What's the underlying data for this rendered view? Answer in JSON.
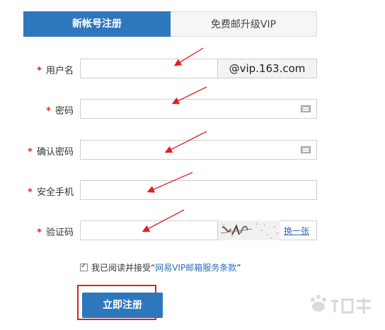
{
  "tabs": [
    {
      "label": "新帐号注册",
      "active": true
    },
    {
      "label": "免费邮升级VIP",
      "active": false
    }
  ],
  "form": {
    "username": {
      "label": "用户名",
      "suffix": "@vip.163.com"
    },
    "password": {
      "label": "密码"
    },
    "confirm_password": {
      "label": "确认密码"
    },
    "phone": {
      "label": "安全手机"
    },
    "captcha": {
      "label": "验证码",
      "refresh": "换一张"
    },
    "required_mark": "*"
  },
  "agreement": {
    "prefix": "我已阅读并接受“",
    "link": "网易VIP邮箱服务条款",
    "suffix": "”",
    "checked": true
  },
  "submit_label": "立即注册",
  "colors": {
    "accent": "#2f77bd",
    "required": "#d52b1e",
    "annotation": "#e02020"
  }
}
